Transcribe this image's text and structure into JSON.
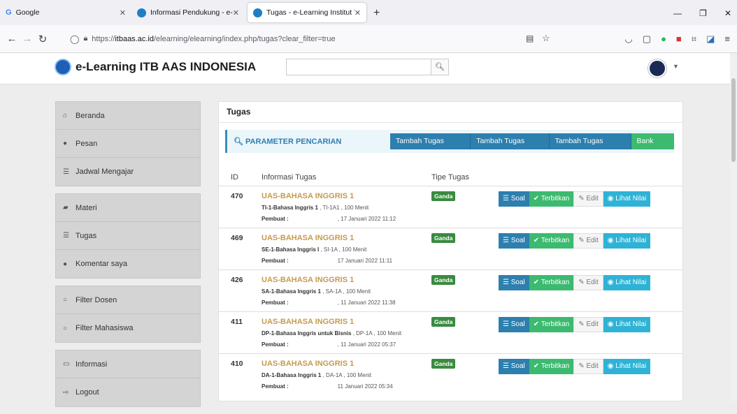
{
  "browser": {
    "tabs": [
      {
        "title": "Google",
        "icon": "google-icon"
      },
      {
        "title": "Informasi Pendukung - e-Learn",
        "icon": "site-favicon"
      },
      {
        "title": "Tugas - e-Learning Institut Tekn",
        "icon": "site-favicon"
      }
    ],
    "url_prefix": "https://",
    "url_domain": "itbaas.ac.id",
    "url_path": "/elearning/elearning/index.php/tugas?clear_filter=true"
  },
  "header": {
    "brand": "e-Learning ITB AAS INDONESIA",
    "search_placeholder": ""
  },
  "sidebar": {
    "groups": [
      {
        "items": [
          {
            "label": "Beranda",
            "icon": "home-icon"
          },
          {
            "label": "Pesan",
            "icon": "chat-icon"
          },
          {
            "label": "Jadwal Mengajar",
            "icon": "list-icon"
          }
        ]
      },
      {
        "items": [
          {
            "label": "Materi",
            "icon": "book-icon"
          },
          {
            "label": "Tugas",
            "icon": "list-icon"
          },
          {
            "label": "Komentar saya",
            "icon": "chat-icon"
          }
        ]
      },
      {
        "items": [
          {
            "label": "Filter Dosen",
            "icon": "search-icon"
          },
          {
            "label": "Filter Mahasiswa",
            "icon": "search-icon"
          }
        ]
      },
      {
        "items": [
          {
            "label": "Informasi",
            "icon": "info-icon"
          },
          {
            "label": "Logout",
            "icon": "logout-icon"
          }
        ]
      }
    ]
  },
  "main": {
    "title": "Tugas",
    "param_label": "PARAMETER PENCARIAN",
    "buttons": [
      "Tambah Tugas Ganda",
      "Tambah Tugas Essay",
      "Tambah Tugas Upload",
      "Bank Soal"
    ],
    "columns": [
      "ID",
      "Informasi Tugas",
      "Tipe Tugas"
    ],
    "action_labels": {
      "soal": "Soal",
      "terbitkan": "Terbitkan",
      "edit": "Edit",
      "lihat": "Lihat Nilai"
    },
    "pembuat_label": "Pembuat :",
    "rows": [
      {
        "id": "470",
        "title": "UAS-BAHASA INGGRIS 1",
        "course": "TI-1-Bahasa Inggris 1",
        "detail": ", TI-1A1 , 100 Menit",
        "date": ", 17 Januari 2022 11:12",
        "type": "Ganda"
      },
      {
        "id": "469",
        "title": "UAS-BAHASA INGGRIS 1",
        "course": "SE-1-Bahasa Inggris I",
        "detail": ", SI-1A , 100 Menit",
        "date": "17 Januari 2022 11:11",
        "type": "Ganda"
      },
      {
        "id": "426",
        "title": "UAS-BAHASA INGGRIS 1",
        "course": "SA-1-Bahasa Inggris 1",
        "detail": ", SA-1A , 100 Menit",
        "date": ", 11 Januari 2022 11:38",
        "type": "Ganda"
      },
      {
        "id": "411",
        "title": "UAS-BAHASA INGGRIS 1",
        "course": "DP-1-Bahasa Inggris untuk Bisnis",
        "detail": ", DP-1A , 100 Menit",
        "date": ", 11 Januari 2022 05:37",
        "type": "Ganda"
      },
      {
        "id": "410",
        "title": "UAS-BAHASA INGGRIS 1",
        "course": "DA-1-Bahasa Inggris 1",
        "detail": ", DA-1A , 100 Menit",
        "date": "11 Januari 2022 05:34",
        "type": "Ganda"
      }
    ]
  }
}
